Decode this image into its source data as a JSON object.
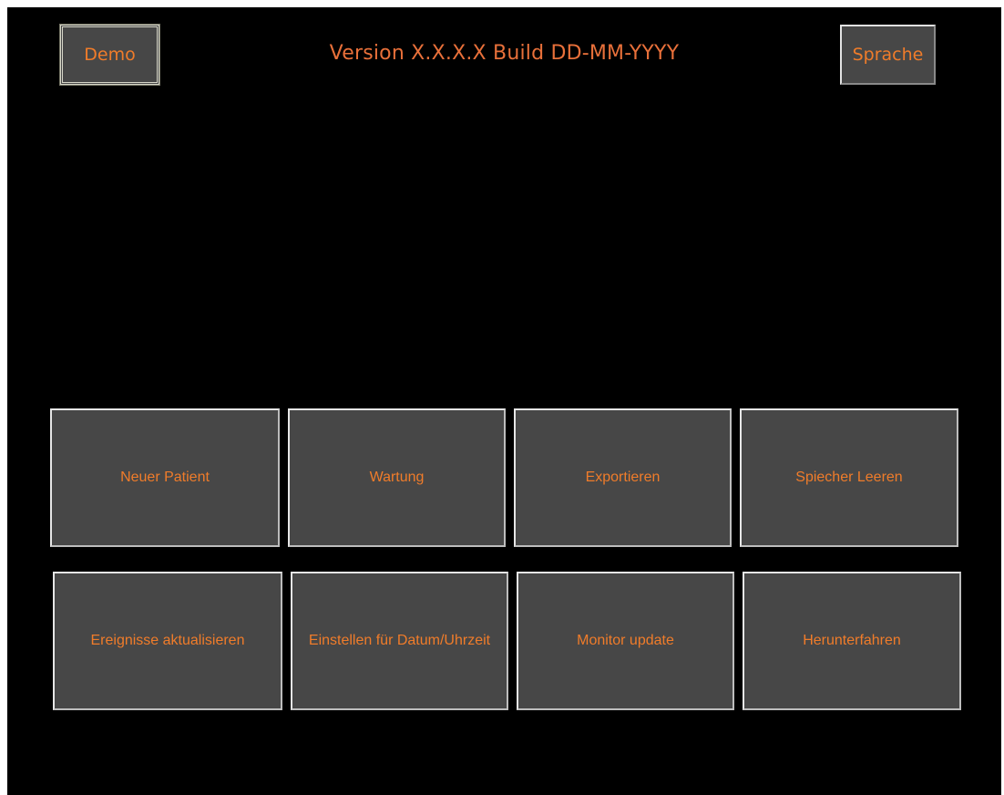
{
  "header": {
    "version_text": "Version X.X.X.X Build DD-MM-YYYY",
    "demo_label": "Demo",
    "language_label": "Sprache"
  },
  "menu": {
    "row1": [
      {
        "label": "Neuer Patient"
      },
      {
        "label": "Wartung"
      },
      {
        "label": "Exportieren"
      },
      {
        "label": "Spiecher Leeren"
      }
    ],
    "row2": [
      {
        "label": "Ereignisse aktualisieren"
      },
      {
        "label": "Einstellen für Datum/Uhrzeit"
      },
      {
        "label": "Monitor update"
      },
      {
        "label": "Herunterfahren"
      }
    ]
  },
  "colors": {
    "background": "#000000",
    "button_face": "#474747",
    "accent_text": "#f07c2a"
  }
}
